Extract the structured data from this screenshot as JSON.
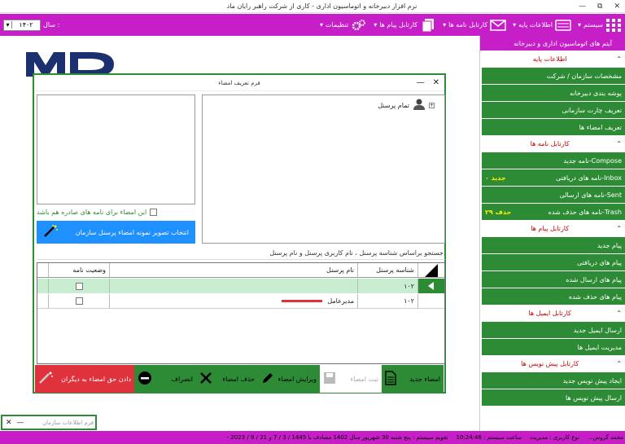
{
  "window": {
    "title": "نرم افزار دبیرخانه و اتوماسیون اداری - کاری از شرکت راهبر رایان ماد",
    "minimize": "—",
    "maximize": "⧉",
    "close": "✕"
  },
  "menubar": {
    "year_label": "سال :",
    "year_value": "۱۴۰۲",
    "items": [
      {
        "label": "سیستم",
        "icon": "grid-icon"
      },
      {
        "label": "اطلاعات پایه",
        "icon": "keyboard-icon"
      },
      {
        "label": "کارتابل نامه ها",
        "icon": "envelope-icon"
      },
      {
        "label": "کارتابل پیام ها",
        "icon": "documents-icon"
      },
      {
        "label": "تنظیمات",
        "icon": "gears-icon"
      }
    ]
  },
  "sidebar": {
    "header": "آیتم های اتوماسیون اداری و دبیرخانه",
    "sections": [
      {
        "title": "اطلاعات پایه",
        "items": [
          {
            "label": "مشخصات سازمان / شرکت"
          },
          {
            "label": "پوشه بندی دبیرخانه"
          },
          {
            "label": "تعریف چارت سازمانی"
          },
          {
            "label": "تعریف امضاء ها"
          }
        ]
      },
      {
        "title": "کارتابل نامه ها",
        "items": [
          {
            "label": "نامه جدید-Compose"
          },
          {
            "label": "نامه های دریافتی-Inbox",
            "count": "۰ جدید"
          },
          {
            "label": "نامه های ارسالی-Sent"
          },
          {
            "label": "نامه های حذف شده-Trash",
            "count": "۲۹ حذف"
          }
        ]
      },
      {
        "title": "کارتابل پیام ها",
        "items": [
          {
            "label": "پیام جدید"
          },
          {
            "label": "پیام های دریافتی"
          },
          {
            "label": "پیام های ارسال شده"
          },
          {
            "label": "پیام های حذف شده"
          }
        ]
      },
      {
        "title": "کارتابل ایمیل ها",
        "items": [
          {
            "label": "ارسال ایمیل جدید"
          },
          {
            "label": "مدیریت ایمیل ها"
          }
        ]
      },
      {
        "title": "کارتابل پیش نویس ها",
        "items": [
          {
            "label": "ایجاد پیش نویس جدید"
          },
          {
            "label": "ارسال پیش نویس ها"
          }
        ]
      }
    ]
  },
  "dialog": {
    "title": "فرم تعریف امضاء",
    "tree_root": "تمام پرسنل",
    "checkbox_label": "این امضاء برای نامه های صادره هم باشد",
    "select_image_button": "انتخاب تصویر نمونه امضاء پرسنل سازمان",
    "search_label": "جستجو براساس شناسه پرسنل ، نام کاربری پرسنل و نام پرسنل",
    "grid": {
      "headers": {
        "id": "شناسه پرسنل",
        "name": "نام پرسنل",
        "status": "وضعیت نامه"
      },
      "rows": [
        {
          "id": "۱۰۲",
          "name": ""
        },
        {
          "id": "۱۰۲",
          "name": "مدیرعامل"
        }
      ]
    },
    "toolbar": {
      "new": "امضاء جدید",
      "save": "ثبت امضاء",
      "edit": "ویرایش امضاء",
      "delete": "حذف امضاء",
      "cancel": "انصراف",
      "grant": "دادن حق امضاء به دیگران"
    }
  },
  "minimized_form": {
    "title": "فرم اطلاعات سازمان"
  },
  "statusbar": {
    "user_type": "نوع کاربری : مدیریت",
    "user_name": "محمد گروس...",
    "time": "ساعت سیستم : 10:24:46",
    "calendar": "تقویم سیستم : پنج شنبه 30 شهریور سال 1402 مصادف با 1445 / 3 / 7 و 21 / 9 / 2023 -"
  },
  "colors": {
    "accent": "#c71fc7",
    "green": "#2e8b35",
    "blue": "#1e90ff",
    "red": "#e0323c"
  }
}
